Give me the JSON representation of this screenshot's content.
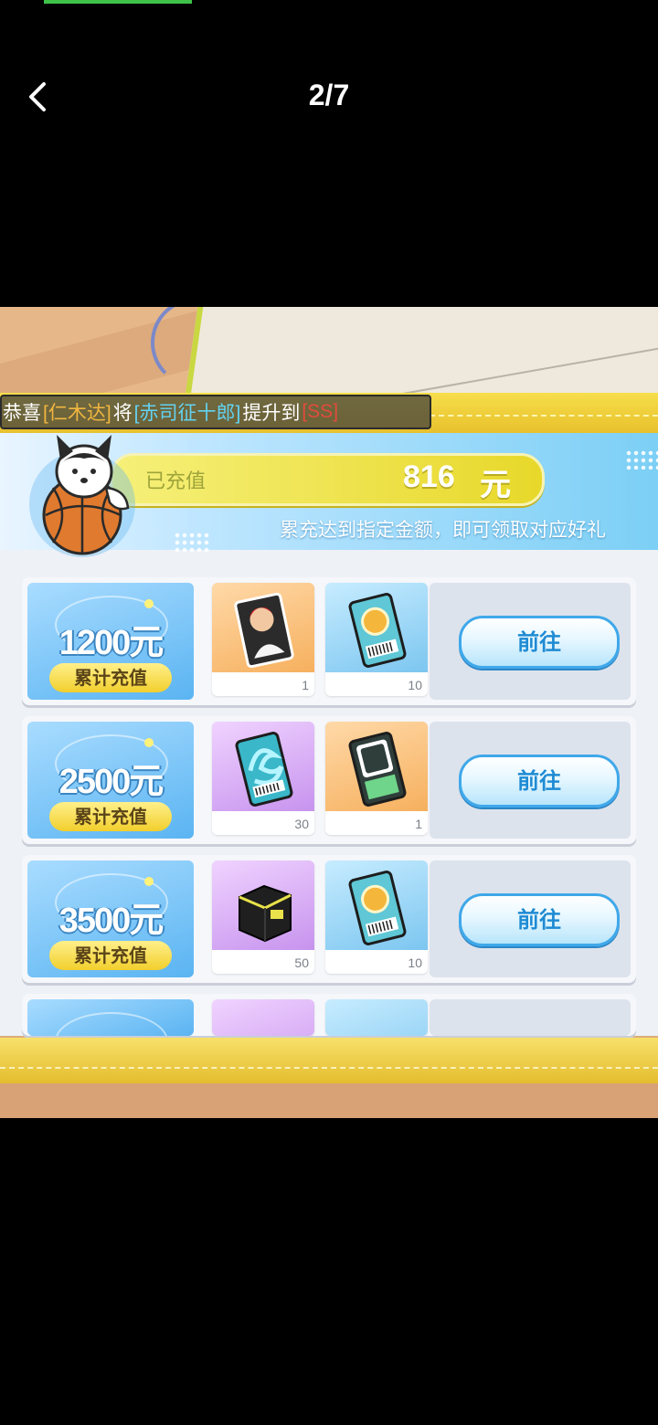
{
  "viewer": {
    "page_counter": "2/7",
    "accent_color": "#3fc24a"
  },
  "screenshot": {
    "marquee": {
      "prefix": "恭喜",
      "player": "[仁木达]",
      "verb": "将",
      "character": "[赤司征十郎]",
      "suffix": "提升到",
      "level": "[SS]"
    },
    "recharge": {
      "label": "已充值",
      "amount": "816",
      "unit": "元",
      "notice": "累充达到指定金额，即可领取对应好礼"
    },
    "tiers": [
      {
        "amount": "1200元",
        "label": "累计充值",
        "rewards": [
          {
            "icon": "player-card-icon",
            "count": "1",
            "bg": "orange"
          },
          {
            "icon": "ticket-card-icon",
            "count": "10",
            "bg": "blue"
          }
        ],
        "button": "前往"
      },
      {
        "amount": "2500元",
        "label": "累计充值",
        "rewards": [
          {
            "icon": "swirl-card-icon",
            "count": "30",
            "bg": "purple"
          },
          {
            "icon": "coupon-card-icon",
            "count": "1",
            "bg": "orange"
          }
        ],
        "button": "前往"
      },
      {
        "amount": "3500元",
        "label": "累计充值",
        "rewards": [
          {
            "icon": "treasure-box-icon",
            "count": "50",
            "bg": "purple"
          },
          {
            "icon": "ticket-card-icon",
            "count": "10",
            "bg": "blue"
          }
        ],
        "button": "前往"
      }
    ]
  }
}
